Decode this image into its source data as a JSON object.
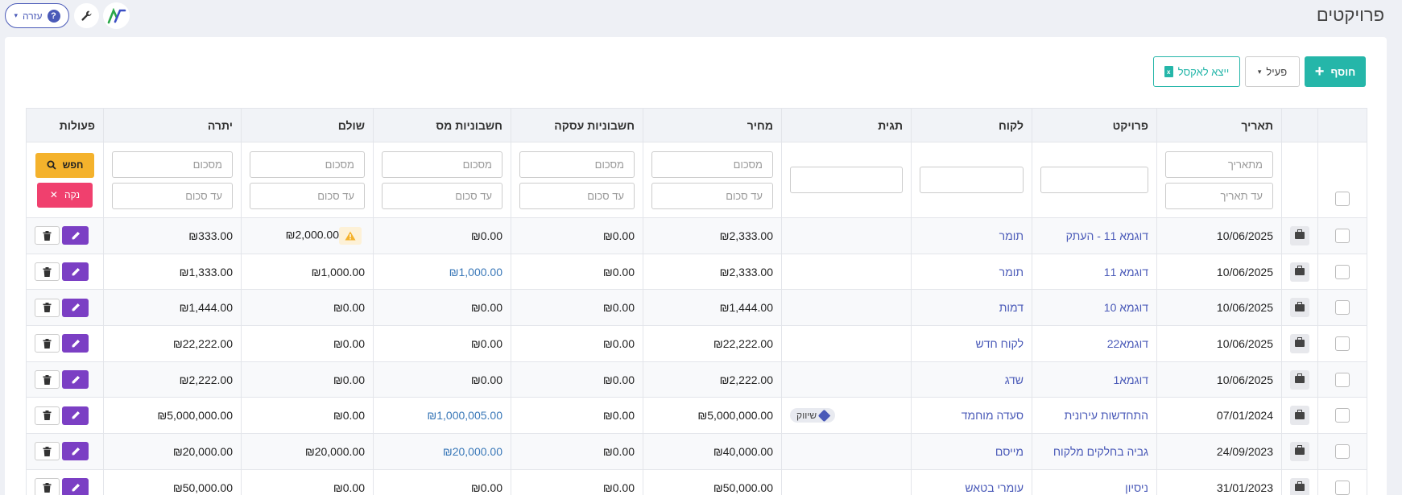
{
  "header": {
    "title": "פרויקטים",
    "help_label": "עזרה",
    "help_icon": "?"
  },
  "toolbar": {
    "add_label": "חוסף",
    "status_label": "פעיל",
    "excel_label": "ייצא לאקסל"
  },
  "columns": [
    "",
    "",
    "תאריך",
    "פרויקט",
    "לקוח",
    "תגית",
    "מחיר",
    "חשבוניות עסקה",
    "חשבוניות מס",
    "שולם",
    "יתרה",
    "פעולות"
  ],
  "filters": {
    "date_from": "מתאריך",
    "date_to": "עד תאריך",
    "amount_from": "מסכום",
    "amount_to": "עד סכום",
    "search_label": "חפש",
    "clear_label": "נקה"
  },
  "rows": [
    {
      "date": "10/06/2025",
      "project": "דוגמא 11 - העתק",
      "client": "תומר",
      "tag": "",
      "price": "₪2,333.00",
      "deal_invoices": "₪0.00",
      "tax_invoices": "₪0.00",
      "paid": "₪2,000.00",
      "balance": "₪333.00"
    },
    {
      "date": "10/06/2025",
      "project": "דוגמא 11",
      "client": "תומר",
      "tag": "",
      "price": "₪2,333.00",
      "deal_invoices": "₪0.00",
      "tax_invoices": "₪1,000.00",
      "paid": "₪1,000.00",
      "balance": "₪1,333.00"
    },
    {
      "date": "10/06/2025",
      "project": "דוגמא 10",
      "client": "דמות",
      "tag": "",
      "price": "₪1,444.00",
      "deal_invoices": "₪0.00",
      "tax_invoices": "₪0.00",
      "paid": "₪0.00",
      "balance": "₪1,444.00"
    },
    {
      "date": "10/06/2025",
      "project": "דוגמא22",
      "client": "לקוח חדש",
      "tag": "",
      "price": "₪22,222.00",
      "deal_invoices": "₪0.00",
      "tax_invoices": "₪0.00",
      "paid": "₪0.00",
      "balance": "₪22,222.00"
    },
    {
      "date": "10/06/2025",
      "project": "דוגמא1",
      "client": "שדג",
      "tag": "",
      "price": "₪2,222.00",
      "deal_invoices": "₪0.00",
      "tax_invoices": "₪0.00",
      "paid": "₪0.00",
      "balance": "₪2,222.00"
    },
    {
      "date": "07/01/2024",
      "project": "התחדשות עירונית",
      "client": "סעדה מוחמד",
      "tag": "שיווק",
      "price": "₪5,000,000.00",
      "deal_invoices": "₪0.00",
      "tax_invoices": "₪1,000,005.00",
      "paid": "₪0.00",
      "balance": "₪5,000,000.00"
    },
    {
      "date": "24/09/2023",
      "project": "גביה בחלקים מלקוח",
      "client": "מייסם",
      "tag": "",
      "price": "₪40,000.00",
      "deal_invoices": "₪0.00",
      "tax_invoices": "₪20,000.00",
      "paid": "₪20,000.00",
      "balance": "₪20,000.00"
    },
    {
      "date": "31/01/2023",
      "project": "ניסיון",
      "client": "עומרי בטאש",
      "tag": "",
      "price": "₪50,000.00",
      "deal_invoices": "₪0.00",
      "tax_invoices": "₪0.00",
      "paid": "₪0.00",
      "balance": "₪50,000.00"
    }
  ],
  "colors": {
    "teal": "#25b6a9",
    "purple": "#7b3fc4",
    "link": "#4a5ab8",
    "search": "#f4b22c",
    "clear": "#f0406e"
  }
}
